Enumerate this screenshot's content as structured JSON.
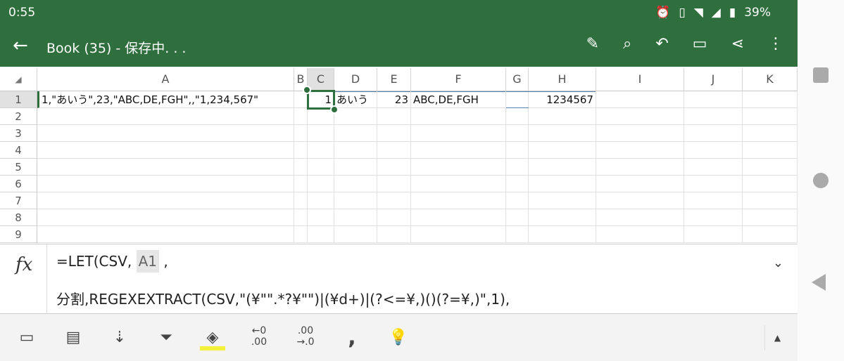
{
  "status": {
    "time": "0:55",
    "battery": "39%",
    "icons": [
      "alarm-icon",
      "vibrate-icon",
      "wifi-icon",
      "signal-icon",
      "battery-icon"
    ]
  },
  "titlebar": {
    "title": "Book (35) - 保存中. . .",
    "icons": [
      "pen-icon",
      "search-icon",
      "undo-icon",
      "comment-icon",
      "share-icon",
      "more-icon"
    ]
  },
  "columns": [
    "A",
    "B",
    "C",
    "D",
    "E",
    "F",
    "G",
    "H",
    "I",
    "J",
    "K"
  ],
  "rows": [
    "1",
    "2",
    "3",
    "4",
    "5",
    "6",
    "7",
    "8",
    "9"
  ],
  "cells": {
    "A1": "1,\"あいう\",23,\"ABC,DE,FGH\",,\"1,234,567\"",
    "C1": "1",
    "D1": "あいう",
    "E1": "23",
    "F1": "ABC,DE,FGH",
    "H1": "1234567"
  },
  "formula": {
    "line1_start": "=LET(CSV, ",
    "line1_ref": "A1",
    "line1_end": " ,",
    "line2": "分割,REGEXEXTRACT(CSV,\"(¥\"\".*?¥\"\")|(¥d+)|(?<=¥,)()(?=¥,)\",1),"
  },
  "toolbar": {
    "decimal_increase": "←0\n.00",
    "decimal_decrease": ".00\n→.0",
    "comma": ","
  },
  "colors": {
    "accent": "#2f6e3d"
  }
}
